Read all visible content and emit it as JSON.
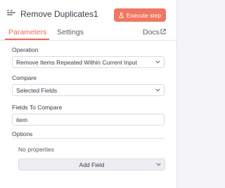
{
  "header": {
    "title": "Remove Duplicates1",
    "execute_label": "Execute step",
    "node_icon": "node-icon",
    "execute_icon": "flask-icon"
  },
  "tabs": [
    {
      "label": "Parameters",
      "active": true
    },
    {
      "label": "Settings",
      "active": false
    },
    {
      "label": "Docs",
      "icon": "external-link-icon",
      "active": false
    }
  ],
  "params": {
    "operation": {
      "label": "Operation",
      "value": "Remove Items Repeated Within Current Input"
    },
    "compare": {
      "label": "Compare",
      "value": "Selected Fields"
    },
    "fields_to_compare": {
      "label": "Fields To Compare",
      "value": "item"
    },
    "options": {
      "label": "Options",
      "empty_text": "No properties",
      "add_label": "Add Field"
    }
  },
  "colors": {
    "accent": "#ee6b54",
    "execute_bg": "#f07762"
  }
}
